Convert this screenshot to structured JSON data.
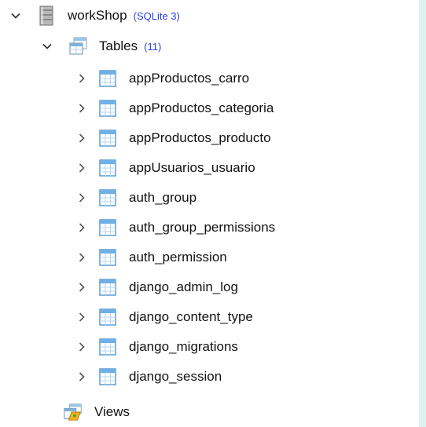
{
  "tree": {
    "database": {
      "name": "workShop",
      "engine": "(SQLite 3)"
    },
    "tables_node": {
      "label": "Tables",
      "count": "(11)"
    },
    "tables": [
      {
        "name": "appProductos_carro"
      },
      {
        "name": "appProductos_categoria"
      },
      {
        "name": "appProductos_producto"
      },
      {
        "name": "appUsuarios_usuario"
      },
      {
        "name": "auth_group"
      },
      {
        "name": "auth_group_permissions"
      },
      {
        "name": "auth_permission"
      },
      {
        "name": "django_admin_log"
      },
      {
        "name": "django_content_type"
      },
      {
        "name": "django_migrations"
      },
      {
        "name": "django_session"
      }
    ],
    "views_node": {
      "label": "Views"
    }
  },
  "icons": {
    "database": "database-icon",
    "tables_folder": "tables-folder-icon",
    "table": "table-icon",
    "views": "views-icon",
    "expanded": "chevron-down-icon",
    "collapsed": "chevron-right-icon"
  },
  "colors": {
    "engine_text": "#2a3de0",
    "background_strip": "#dff3ee"
  }
}
